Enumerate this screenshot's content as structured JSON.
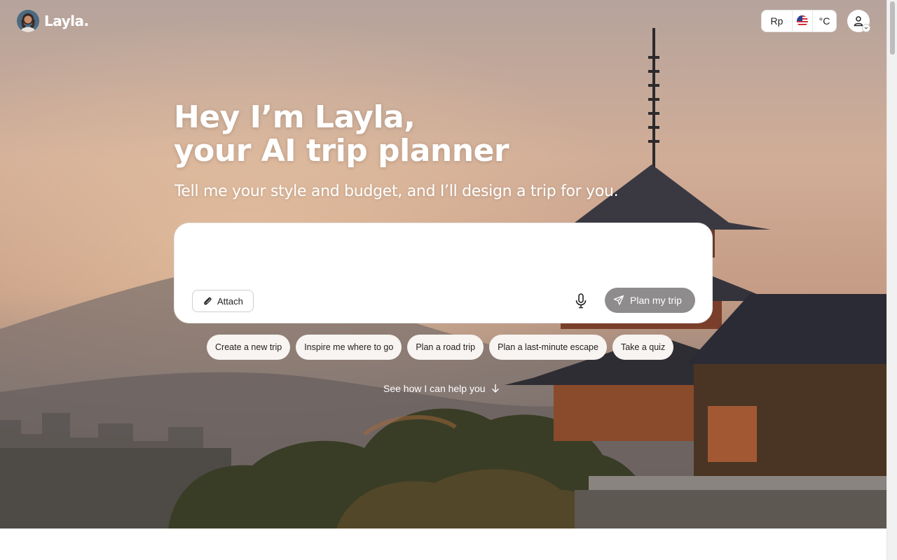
{
  "brand": {
    "name": "Layla."
  },
  "header": {
    "currency": "Rp",
    "temperature_unit": "°C",
    "flag_icon": "us-flag-icon",
    "user_icon": "user-icon"
  },
  "hero": {
    "headline_line1": "Hey I’m Layla,",
    "headline_line2": "your AI trip planner",
    "subline": "Tell me your style and budget, and I’ll design a trip for you."
  },
  "prompt": {
    "value": "",
    "attach_label": "Attach",
    "submit_label": "Plan my trip",
    "submit_color": "#8f8c8d"
  },
  "suggestions": [
    "Create a new trip",
    "Inspire me where to go",
    "Plan a road trip",
    "Plan a last-minute escape",
    "Take a quiz"
  ],
  "see_how": "See how I can help you"
}
